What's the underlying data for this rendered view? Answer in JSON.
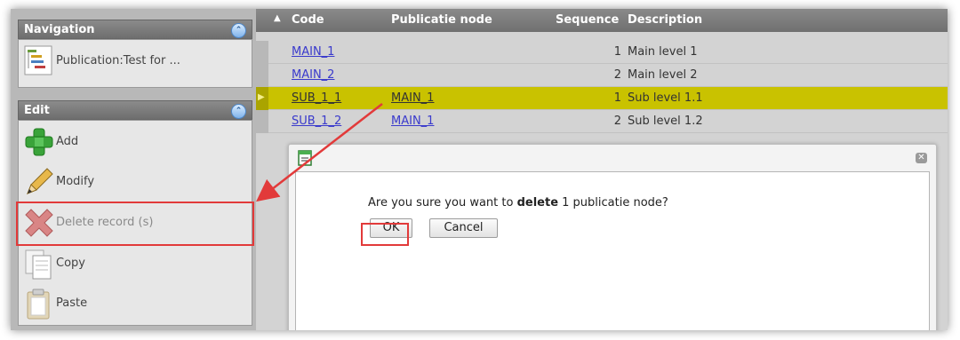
{
  "navigation": {
    "title": "Navigation",
    "item_label": "Publication:Test for ..."
  },
  "edit": {
    "title": "Edit",
    "items": [
      {
        "label": "Add",
        "icon": "add-icon"
      },
      {
        "label": "Modify",
        "icon": "pencil-icon"
      },
      {
        "label": "Delete record (s)",
        "icon": "delete-icon"
      },
      {
        "label": "Copy",
        "icon": "copy-icon"
      },
      {
        "label": "Paste",
        "icon": "paste-icon"
      }
    ]
  },
  "grid": {
    "columns": [
      "Code",
      "Publicatie node",
      "Sequence",
      "Description"
    ],
    "rows": [
      {
        "code": "MAIN_1",
        "node": "",
        "sequence": "1",
        "description": "Main level 1"
      },
      {
        "code": "MAIN_2",
        "node": "",
        "sequence": "2",
        "description": "Main level 2"
      },
      {
        "code": "SUB_1_1",
        "node": "MAIN_1",
        "sequence": "1",
        "description": "Sub level 1.1"
      },
      {
        "code": "SUB_1_2",
        "node": "MAIN_1",
        "sequence": "2",
        "description": "Sub level 1.2"
      }
    ]
  },
  "dialog": {
    "message_before": "Are you sure you want to ",
    "message_bold": "delete",
    "message_after": " 1 publicatie node?",
    "ok_label": "OK",
    "cancel_label": "Cancel"
  },
  "colors": {
    "selected_row": "#c9c200",
    "highlight": "#e23a3a",
    "link": "#3a3acc"
  }
}
